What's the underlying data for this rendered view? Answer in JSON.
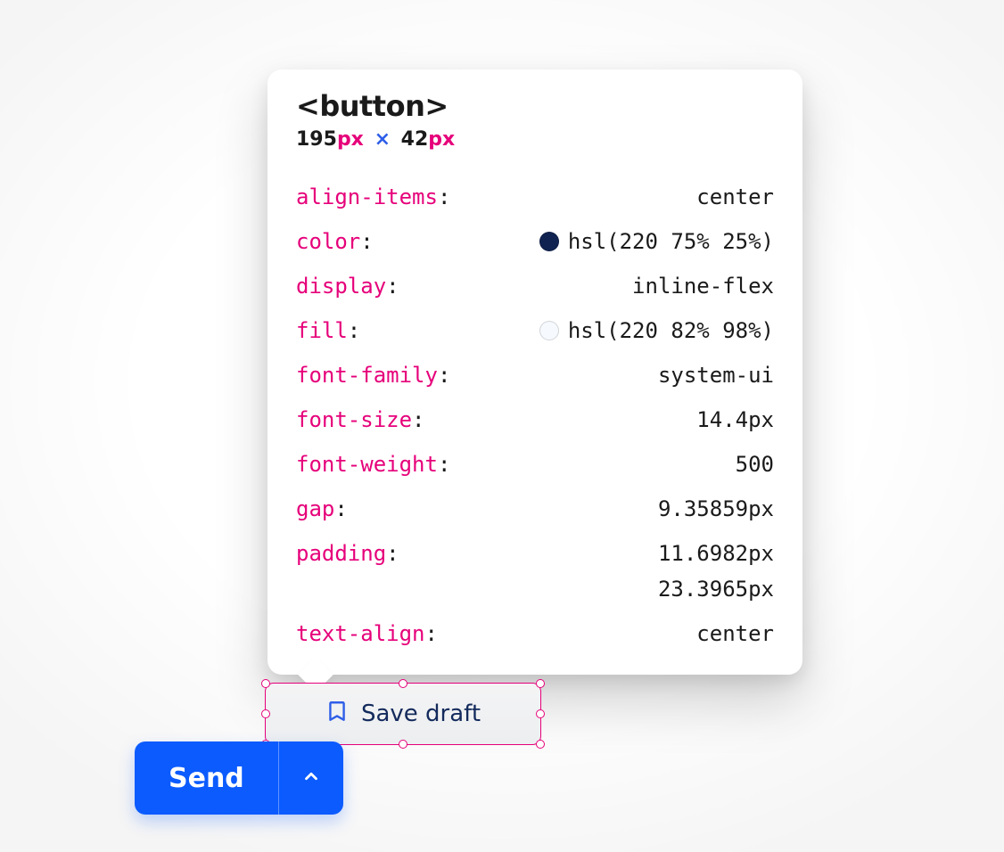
{
  "inspector": {
    "tag": "<button>",
    "dims": {
      "w": "195",
      "wUnit": "px",
      "sep": "×",
      "h": "42",
      "hUnit": "px"
    },
    "props": [
      {
        "key": "align-items",
        "value": "center"
      },
      {
        "key": "color",
        "value": "hsl(220 75% 25%)",
        "swatch": "#10224f"
      },
      {
        "key": "display",
        "value": "inline-flex"
      },
      {
        "key": "fill",
        "value": "hsl(220 82% 98%)",
        "swatch": "#f6f9fe"
      },
      {
        "key": "font-family",
        "value": "system-ui"
      },
      {
        "key": "font-size",
        "value": "14.4px"
      },
      {
        "key": "font-weight",
        "value": "500"
      },
      {
        "key": "gap",
        "value": "9.35859px"
      },
      {
        "key": "padding",
        "values": [
          "11.6982px",
          "23.3965px"
        ]
      },
      {
        "key": "text-align",
        "value": "center"
      }
    ]
  },
  "saveDraft": {
    "label": "Save draft"
  },
  "send": {
    "label": "Send"
  }
}
